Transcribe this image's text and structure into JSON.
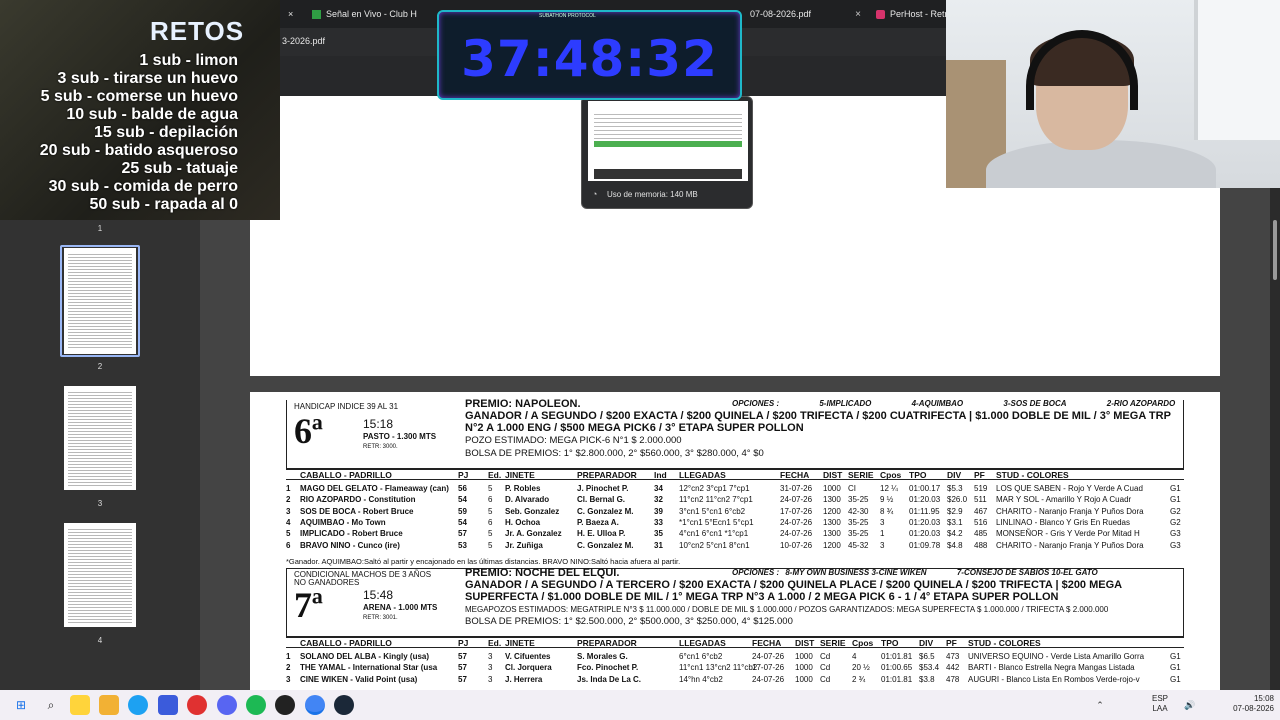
{
  "browser": {
    "tabs": [
      {
        "label": "Señal en Vivo - Club H",
        "close": "×"
      },
      {
        "label": "07-08-2026.pdf",
        "close": "×"
      },
      {
        "label": "PerHost - Retra",
        "close": ""
      }
    ],
    "first_close": "×",
    "document_name": "3-2026.pdf",
    "memory_popup": {
      "text": "Uso de memoria: 140 MB"
    }
  },
  "thumbnails": {
    "pages": [
      "1",
      "2",
      "3",
      "4"
    ],
    "active": 2
  },
  "retos": {
    "title": "RETOS",
    "items": [
      "1 sub - limon",
      "3 sub - tirarse un huevo",
      "5 sub - comerse un huevo",
      "10 sub - balde de agua",
      "15 sub - depilación",
      "20 sub - batido asqueroso",
      "25 sub - tatuaje",
      "30 sub - comida de perro",
      "50 sub - rapada al 0"
    ]
  },
  "timer": {
    "value": "37:48:32",
    "tag": "SUBATHON PROTOCOL"
  },
  "pdf": {
    "columns": [
      "CABALLO - PADRILLO",
      "PJ",
      "Ed.",
      "JINETE",
      "PREPARADOR",
      "Ind",
      "LLEGADAS",
      "FECHA",
      "DIST",
      "SERIE",
      "Cpos",
      "TPO",
      "DIV",
      "PF",
      "STUD - COLORES"
    ],
    "races": [
      {
        "type": "HANDICAP INDICE 39 AL 31",
        "number": "6ª",
        "time": "15:18",
        "track": "PASTO - 1.300 MTS",
        "retr": "RETR: 3000.",
        "prize": "PREMIO: NAPOLEON.",
        "options_label": "OPCIONES :",
        "options": [
          "5-IMPLICADO",
          "4-AQUIMBAO",
          "3-SOS DE BOCA",
          "2-RIO AZOPARDO"
        ],
        "bets": "GANADOR / A SEGUNDO / $200 EXACTA / $200 QUINELA / $200 TRIFECTA / $200 CUATRIFECTA | $1.000 DOBLE DE MIL / 3° MEGA TRP N°2 A 1.000 ENG / $500 MEGA PICK6 / 3° ETAPA SUPER POLLON",
        "estimate": "POZO ESTIMADO: MEGA PICK-6 N°1 $ 2.000.000",
        "purse": "BOLSA DE PREMIOS: 1° $2.800.000, 2° $560.000, 3° $280.000, 4° $0",
        "runners": [
          [
            "1",
            "MAGO DEL GELATO - Flameaway (can)",
            "56",
            "5",
            "P. Robles",
            "J. Pinochet P.",
            "34",
            "12°cn2 3°cp1 7°cp1",
            "31-07-26",
            "1000",
            "CI",
            "12 ¼",
            "01:00.17",
            "$5.3",
            "519",
            "LOS QUE SABEN - Rojo  Y Verde A Cuad",
            "G1"
          ],
          [
            "2",
            "RIO AZOPARDO - Constitution",
            "54",
            "6",
            "D. Alvarado",
            "Cl. Bernal G.",
            "32",
            "11°cn2 11°cn2 7°cp1",
            "24-07-26",
            "1300",
            "35-25",
            "9 ½",
            "01:20.03",
            "$26.0",
            "511",
            "MAR Y SOL - Amarillo  Y Rojo A Cuadr",
            "G1"
          ],
          [
            "3",
            "SOS DE BOCA - Robert Bruce",
            "59",
            "5",
            "Seb. Gonzalez",
            "C. Gonzalez M.",
            "39",
            "3°cn1 5°cn1 6°cb2",
            "17-07-26",
            "1200",
            "42-30",
            "8 ¾",
            "01:11.95",
            "$2.9",
            "467",
            "CHARITO - Naranjo Franja Y Puños Dora",
            "G2"
          ],
          [
            "4",
            "AQUIMBAO - Mo Town",
            "54",
            "6",
            "H. Ochoa",
            "P. Baeza A.",
            "33",
            "*1°cn1 5°Ecn1 5°cp1",
            "24-07-26",
            "1300",
            "35-25",
            "3",
            "01:20.03",
            "$3.1",
            "516",
            "LINLINAO - Blanco  Y Gris En Ruedas",
            "G2"
          ],
          [
            "5",
            "IMPLICADO - Robert Bruce",
            "57",
            "5",
            "Jr. A. Gonzalez",
            "H. E. Ulloa P.",
            "35",
            "4°cn1 6°cn1 *1°cp1",
            "24-07-26",
            "1300",
            "35-25",
            "1",
            "01:20.03",
            "$4.2",
            "485",
            "MONSEÑOR - Gris  Y Verde Por Mitad H",
            "G3"
          ],
          [
            "6",
            "BRAVO NINO - Cunco (ire)",
            "53",
            "5",
            "Jr. Zuñiga",
            "C. Gonzalez M.",
            "31",
            "10°cn2 5°cn1 8°cn1",
            "10-07-26",
            "1200",
            "45-32",
            "3",
            "01:09.78",
            "$4.8",
            "488",
            "CHARITO - Naranjo Franja Y Puños Dora",
            "G3"
          ]
        ],
        "note": "*Ganador. AQUIMBAO:Saltó al partir y encajonado en las últimas distancias. BRAVO NINO:Saltó hacia afuera al partir."
      },
      {
        "type": "CONDICIONAL MACHOS DE 3 AÑOS NO GANADORES",
        "number": "7ª",
        "time": "15:48",
        "track": "ARENA - 1.000 MTS",
        "retr": "RETR: 3001.",
        "prize": "PREMIO: NOCHE DEL ELQUI.",
        "options_label": "OPCIONES :",
        "options": [
          "8-MY OWN BUSINESS",
          "3-CINE WIKEN",
          "7-CONSEJO DE SABIOS",
          "10-EL GATO"
        ],
        "bets": "GANADOR / A SEGUNDO / A TERCERO / $200 EXACTA / $200 QUINELA PLACE / $200 QUINELA / $200 TRIFECTA | $200 MEGA SUPERFECTA / $1.000 DOBLE DE MIL / 1° MEGA TRP N°3 A 1.000 / 2 MEGA PICK 6 - 1 / 4° ETAPA SUPER POLLON",
        "estimate": "MEGAPOZOS ESTIMADOS: MEGATRIPLE N°3 $ 11.000.000 / DOBLE DE MIL $ 1.000.000 / POZOS GARANTIZADOS: MEGA SUPERFECTA $ 1.000.000  / TRIFECTA $ 2.000.000",
        "purse": "BOLSA DE PREMIOS: 1° $2.500.000, 2° $500.000, 3° $250.000, 4° $125.000",
        "runners": [
          [
            "1",
            "SOLANO DEL ALBA - Kingly (usa)",
            "57",
            "3",
            "V. Cifuentes",
            "S. Morales G.",
            "",
            "6°cn1 6°cb2",
            "24-07-26",
            "1000",
            "Cd",
            "4",
            "01:01.81",
            "$6.5",
            "473",
            "UNIVERSO EQUINO - Verde  Lista Amarillo Gorra",
            "G1"
          ],
          [
            "2",
            "THE YAMAL - International Star (usa",
            "57",
            "3",
            "Cl. Jorquera",
            "Fco. Pinochet P.",
            "",
            "11°cn1 13°cn2 11°cb2",
            "17-07-26",
            "1000",
            "Cd",
            "20 ½",
            "01:00.65",
            "$53.4",
            "442",
            "BARTI - Blanco  Estrella Negra Mangas Listada",
            "G1"
          ],
          [
            "3",
            "CINE WIKEN - Valid Point (usa)",
            "57",
            "3",
            "J. Herrera",
            "Js. Inda De La C.",
            "",
            "14°hn 4°cb2",
            "24-07-26",
            "1000",
            "Cd",
            "2 ¾",
            "01:01.81",
            "$3.8",
            "478",
            "AUGURI - Blanco  Lista En Rombos Verde-rojo-v",
            "G1"
          ]
        ]
      }
    ]
  },
  "taskbar": {
    "lang": "ESP\nLAA",
    "time": "15:08",
    "date": "07-08-2026"
  }
}
